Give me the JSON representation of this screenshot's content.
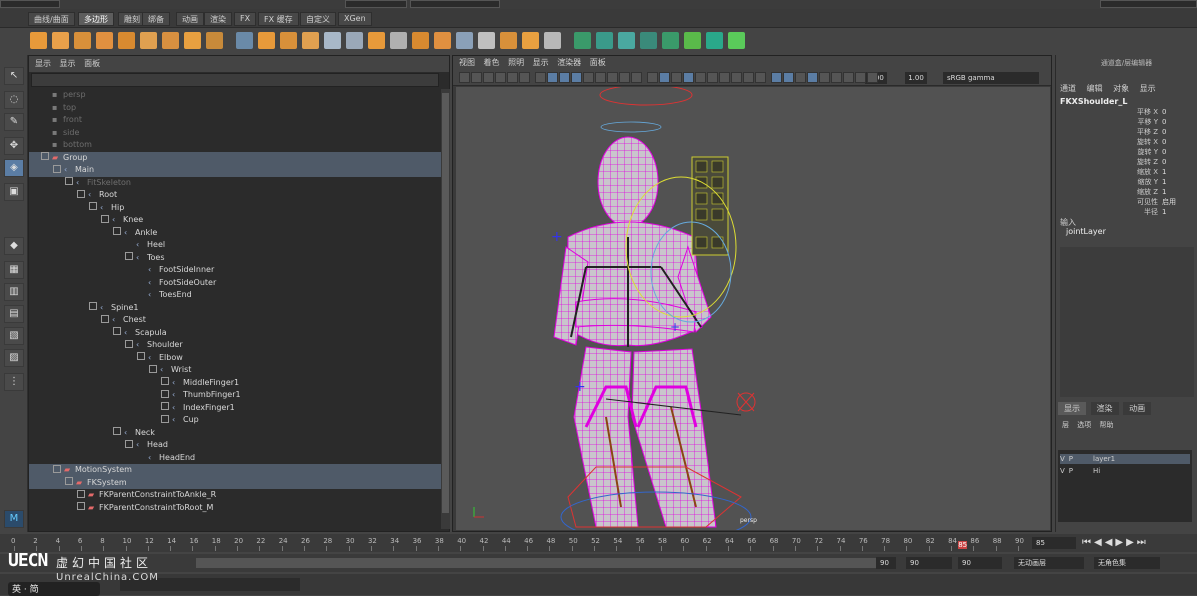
{
  "shelf_tabs": [
    "曲线/曲面",
    "多边形",
    "雕刻",
    "绑备",
    "动画",
    "渲染",
    "FX",
    "FX 缓存",
    "自定义",
    "XGen"
  ],
  "shelf_active": "多边形",
  "outliner": {
    "menu": [
      "显示",
      "显示",
      "面板"
    ],
    "rows": [
      {
        "depth": 0,
        "label": "persp",
        "kind": "cam",
        "exp": "",
        "sel": false,
        "dim": true
      },
      {
        "depth": 0,
        "label": "top",
        "kind": "cam",
        "exp": "",
        "sel": false,
        "dim": true
      },
      {
        "depth": 0,
        "label": "front",
        "kind": "cam",
        "exp": "",
        "sel": false,
        "dim": true
      },
      {
        "depth": 0,
        "label": "side",
        "kind": "cam",
        "exp": "",
        "sel": false,
        "dim": true
      },
      {
        "depth": 0,
        "label": "bottom",
        "kind": "cam",
        "exp": "",
        "sel": false,
        "dim": true
      },
      {
        "depth": 0,
        "label": "Group",
        "kind": "grp",
        "exp": "−",
        "sel": true,
        "dim": false
      },
      {
        "depth": 1,
        "label": "Main",
        "kind": "jnt",
        "exp": "−",
        "sel": true,
        "dim": false
      },
      {
        "depth": 2,
        "label": "FitSkeleton",
        "kind": "jnt",
        "exp": "−",
        "sel": false,
        "dim": true
      },
      {
        "depth": 3,
        "label": "Root",
        "kind": "jnt",
        "exp": "−",
        "sel": false,
        "dim": false
      },
      {
        "depth": 4,
        "label": "Hip",
        "kind": "jnt",
        "exp": "−",
        "sel": false,
        "dim": false
      },
      {
        "depth": 5,
        "label": "Knee",
        "kind": "jnt",
        "exp": "−",
        "sel": false,
        "dim": false
      },
      {
        "depth": 6,
        "label": "Ankle",
        "kind": "jnt",
        "exp": "−",
        "sel": false,
        "dim": false
      },
      {
        "depth": 7,
        "label": "Heel",
        "kind": "jnt",
        "exp": "",
        "sel": false,
        "dim": false
      },
      {
        "depth": 7,
        "label": "Toes",
        "kind": "jnt",
        "exp": "−",
        "sel": false,
        "dim": false
      },
      {
        "depth": 8,
        "label": "FootSideInner",
        "kind": "jnt",
        "exp": "",
        "sel": false,
        "dim": false
      },
      {
        "depth": 8,
        "label": "FootSideOuter",
        "kind": "jnt",
        "exp": "",
        "sel": false,
        "dim": false
      },
      {
        "depth": 8,
        "label": "ToesEnd",
        "kind": "jnt",
        "exp": "",
        "sel": false,
        "dim": false
      },
      {
        "depth": 4,
        "label": "Spine1",
        "kind": "jnt",
        "exp": "−",
        "sel": false,
        "dim": false
      },
      {
        "depth": 5,
        "label": "Chest",
        "kind": "jnt",
        "exp": "−",
        "sel": false,
        "dim": false
      },
      {
        "depth": 6,
        "label": "Scapula",
        "kind": "jnt",
        "exp": "−",
        "sel": false,
        "dim": false
      },
      {
        "depth": 7,
        "label": "Shoulder",
        "kind": "jnt",
        "exp": "−",
        "sel": false,
        "dim": false
      },
      {
        "depth": 8,
        "label": "Elbow",
        "kind": "jnt",
        "exp": "−",
        "sel": false,
        "dim": false
      },
      {
        "depth": 9,
        "label": "Wrist",
        "kind": "jnt",
        "exp": "−",
        "sel": false,
        "dim": false
      },
      {
        "depth": 10,
        "label": "MiddleFinger1",
        "kind": "jnt",
        "exp": "+",
        "sel": false,
        "dim": false
      },
      {
        "depth": 10,
        "label": "ThumbFinger1",
        "kind": "jnt",
        "exp": "+",
        "sel": false,
        "dim": false
      },
      {
        "depth": 10,
        "label": "IndexFinger1",
        "kind": "jnt",
        "exp": "+",
        "sel": false,
        "dim": false
      },
      {
        "depth": 10,
        "label": "Cup",
        "kind": "jnt",
        "exp": "+",
        "sel": false,
        "dim": false
      },
      {
        "depth": 6,
        "label": "Neck",
        "kind": "jnt",
        "exp": "−",
        "sel": false,
        "dim": false
      },
      {
        "depth": 7,
        "label": "Head",
        "kind": "jnt",
        "exp": "−",
        "sel": false,
        "dim": false
      },
      {
        "depth": 8,
        "label": "HeadEnd",
        "kind": "jnt",
        "exp": "",
        "sel": false,
        "dim": false
      },
      {
        "depth": 1,
        "label": "MotionSystem",
        "kind": "grp",
        "exp": "−",
        "sel": true,
        "dim": false
      },
      {
        "depth": 2,
        "label": "FKSystem",
        "kind": "grp",
        "exp": "−",
        "sel": true,
        "dim": false
      },
      {
        "depth": 3,
        "label": "FKParentConstraintToAnkle_R",
        "kind": "grp",
        "exp": "+",
        "sel": false,
        "dim": false
      },
      {
        "depth": 3,
        "label": "FKParentConstraintToRoot_M",
        "kind": "grp",
        "exp": "+",
        "sel": false,
        "dim": false
      }
    ]
  },
  "viewport": {
    "menu": [
      "视图",
      "着色",
      "照明",
      "显示",
      "渲染器",
      "面板"
    ],
    "num1": "0.00",
    "num2": "1.00",
    "colorspace": "sRGB gamma",
    "camera_label": "persp"
  },
  "channel_box": {
    "header": "通道盒/层编辑器",
    "menu": [
      "通道",
      "编辑",
      "对象",
      "显示"
    ],
    "object": "FKXShoulder_L",
    "attrs": [
      {
        "label": "平移 X",
        "value": "0"
      },
      {
        "label": "平移 Y",
        "value": "0"
      },
      {
        "label": "平移 Z",
        "value": "0"
      },
      {
        "label": "旋转 X",
        "value": "0"
      },
      {
        "label": "旋转 Y",
        "value": "0"
      },
      {
        "label": "旋转 Z",
        "value": "0"
      },
      {
        "label": "缩放 X",
        "value": "1"
      },
      {
        "label": "缩放 Y",
        "value": "1"
      },
      {
        "label": "缩放 Z",
        "value": "1"
      },
      {
        "label": "可见性",
        "value": "启用"
      },
      {
        "label": "半径",
        "value": "1"
      }
    ],
    "inputs_label": "输入",
    "input_node": "jointLayer"
  },
  "layers": {
    "tabs": [
      "显示",
      "渲染",
      "动画"
    ],
    "menu": [
      "层",
      "选项",
      "帮助"
    ],
    "rows": [
      {
        "v": "V",
        "p": "P",
        "name": "layer1",
        "sel": true
      },
      {
        "v": "V",
        "p": "P",
        "name": "Hi",
        "sel": false
      }
    ]
  },
  "timeline": {
    "ticks": [
      "0",
      "2",
      "4",
      "6",
      "8",
      "10",
      "12",
      "14",
      "16",
      "18",
      "20",
      "22",
      "24",
      "26",
      "28",
      "30",
      "32",
      "34",
      "36",
      "38",
      "40",
      "42",
      "44",
      "46",
      "48",
      "50",
      "52",
      "54",
      "56",
      "58",
      "60",
      "62",
      "64",
      "66",
      "68",
      "70",
      "72",
      "74",
      "76",
      "78",
      "80",
      "82",
      "84",
      "86",
      "88",
      "90"
    ],
    "current": "85",
    "current_field": "85"
  },
  "range": {
    "end_inner": "90",
    "end_a": "90",
    "end_b": "90",
    "anim_layer": "无动画层",
    "char_set": "无角色集"
  },
  "logo": {
    "big": "UECN",
    "cn": "虚幻中国社区",
    "en": "UnrealChina.COM",
    "ime": "英 · 简 "
  }
}
